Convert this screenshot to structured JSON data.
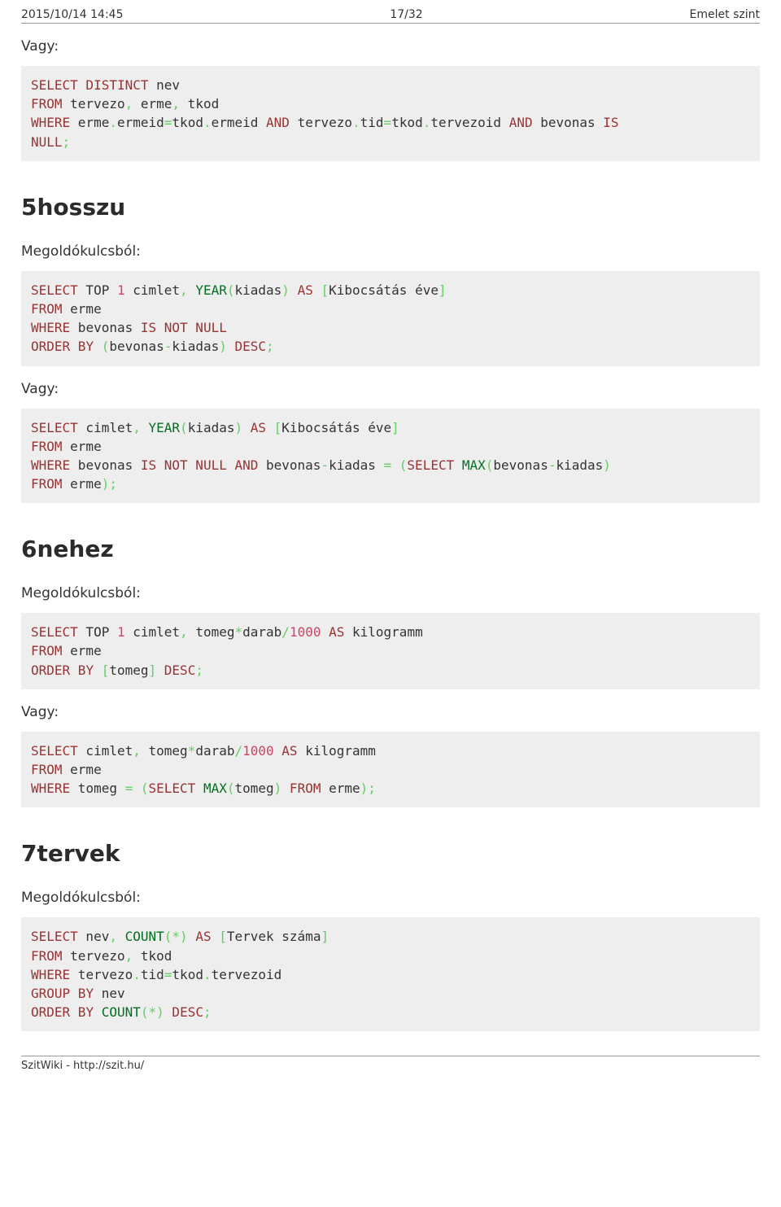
{
  "header": {
    "left": "2015/10/14 14:45",
    "center": "17/32",
    "right": "Emelet szint"
  },
  "strings": {
    "vagy": "Vagy:",
    "megoldo": "Megoldókulcsból:"
  },
  "sections": {
    "s5": {
      "title": "5hosszu"
    },
    "s6": {
      "title": "6nehez"
    },
    "s7": {
      "title": "7tervek"
    }
  },
  "code": {
    "c1": {
      "l1a": "SELECT",
      "l1b": " DISTINCT",
      "l1c": " nev",
      "l2a": "FROM",
      "l2b": " tervezo",
      "l2c": ",",
      "l2d": " erme",
      "l2e": ",",
      "l2f": " tkod",
      "l3a": "WHERE",
      "l3b": " erme",
      "l3c": ".",
      "l3d": "ermeid",
      "l3e": "=",
      "l3f": "tkod",
      "l3g": ".",
      "l3h": "ermeid ",
      "l3i": "AND",
      "l3j": " tervezo",
      "l3k": ".",
      "l3l": "tid",
      "l3m": "=",
      "l3n": "tkod",
      "l3o": ".",
      "l3p": "tervezoid ",
      "l3q": "AND",
      "l3r": " bevonas ",
      "l3s": "IS",
      "l4a": "NULL",
      "l4b": ";"
    },
    "c2": {
      "l1a": "SELECT",
      "l1b": " TOP ",
      "l1c": "1",
      "l1d": " cimlet",
      "l1e": ",",
      "l1f": " YEAR",
      "l1g": "(",
      "l1h": "kiadas",
      "l1i": ")",
      "l1j": " AS",
      "l1k": " [",
      "l1l": "Kibocsátás éve",
      "l1m": "]",
      "l2a": "FROM",
      "l2b": " erme",
      "l3a": "WHERE",
      "l3b": " bevonas ",
      "l3c": "IS",
      "l3d": " NOT",
      "l3e": " NULL",
      "l4a": "ORDER",
      "l4b": " BY",
      "l4c": " (",
      "l4d": "bevonas",
      "l4e": "-",
      "l4f": "kiadas",
      "l4g": ")",
      "l4h": " DESC",
      "l4i": ";"
    },
    "c3": {
      "l1a": "SELECT",
      "l1b": " cimlet",
      "l1c": ",",
      "l1d": " YEAR",
      "l1e": "(",
      "l1f": "kiadas",
      "l1g": ")",
      "l1h": " AS",
      "l1i": " [",
      "l1j": "Kibocsátás éve",
      "l1k": "]",
      "l2a": "FROM",
      "l2b": " erme",
      "l3a": "WHERE",
      "l3b": " bevonas ",
      "l3c": "IS",
      "l3d": " NOT",
      "l3e": " NULL",
      "l3f": " AND",
      "l3g": " bevonas",
      "l3h": "-",
      "l3i": "kiadas ",
      "l3j": "=",
      "l3k": " (",
      "l3l": "SELECT",
      "l3m": " MAX",
      "l3n": "(",
      "l3o": "bevonas",
      "l3p": "-",
      "l3q": "kiadas",
      "l3r": ")",
      "l4a": "FROM",
      "l4b": " erme",
      "l4c": ")",
      "l4d": ";"
    },
    "c4": {
      "l1a": "SELECT",
      "l1b": " TOP ",
      "l1c": "1",
      "l1d": " cimlet",
      "l1e": ",",
      "l1f": " tomeg",
      "l1g": "*",
      "l1h": "darab",
      "l1i": "/",
      "l1j": "1000",
      "l1k": " AS",
      "l1l": " kilogramm",
      "l2a": "FROM",
      "l2b": " erme",
      "l3a": "ORDER",
      "l3b": " BY",
      "l3c": " [",
      "l3d": "tomeg",
      "l3e": "]",
      "l3f": " DESC",
      "l3g": ";"
    },
    "c5": {
      "l1a": "SELECT",
      "l1b": " cimlet",
      "l1c": ",",
      "l1d": " tomeg",
      "l1e": "*",
      "l1f": "darab",
      "l1g": "/",
      "l1h": "1000",
      "l1i": " AS",
      "l1j": " kilogramm",
      "l2a": "FROM",
      "l2b": " erme",
      "l3a": "WHERE",
      "l3b": " tomeg ",
      "l3c": "=",
      "l3d": " (",
      "l3e": "SELECT",
      "l3f": " MAX",
      "l3g": "(",
      "l3h": "tomeg",
      "l3i": ")",
      "l3j": " FROM",
      "l3k": " erme",
      "l3l": ")",
      "l3m": ";"
    },
    "c6": {
      "l1a": "SELECT",
      "l1b": " nev",
      "l1c": ",",
      "l1d": " COUNT",
      "l1e": "(",
      "l1f": "*",
      "l1g": ")",
      "l1h": " AS",
      "l1i": " [",
      "l1j": "Tervek száma",
      "l1k": "]",
      "l2a": "FROM",
      "l2b": " tervezo",
      "l2c": ",",
      "l2d": " tkod",
      "l3a": "WHERE",
      "l3b": " tervezo",
      "l3c": ".",
      "l3d": "tid",
      "l3e": "=",
      "l3f": "tkod",
      "l3g": ".",
      "l3h": "tervezoid",
      "l4a": "GROUP",
      "l4b": " BY",
      "l4c": " nev",
      "l5a": "ORDER",
      "l5b": " BY",
      "l5c": " COUNT",
      "l5d": "(",
      "l5e": "*",
      "l5f": ")",
      "l5g": " DESC",
      "l5h": ";"
    }
  },
  "footer": {
    "text": "SzitWiki - http://szit.hu/"
  }
}
